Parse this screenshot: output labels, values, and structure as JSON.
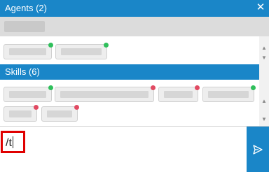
{
  "agents_header": {
    "title": "Agents (2)",
    "close_icon": "close-icon"
  },
  "agents": [
    {
      "status": "green"
    },
    {
      "status": "green"
    }
  ],
  "skills_header": {
    "title": "Skills (6)"
  },
  "skills": [
    {
      "status": "green"
    },
    {
      "status": "red"
    },
    {
      "status": "red"
    },
    {
      "status": "green"
    },
    {
      "status": "red"
    },
    {
      "status": "red"
    }
  ],
  "composer": {
    "input_value": "/t",
    "send_icon": "send-icon"
  },
  "colors": {
    "accent": "#1a86c8",
    "online": "#2fbf5b",
    "busy": "#e14a62",
    "highlight": "#e00000"
  }
}
